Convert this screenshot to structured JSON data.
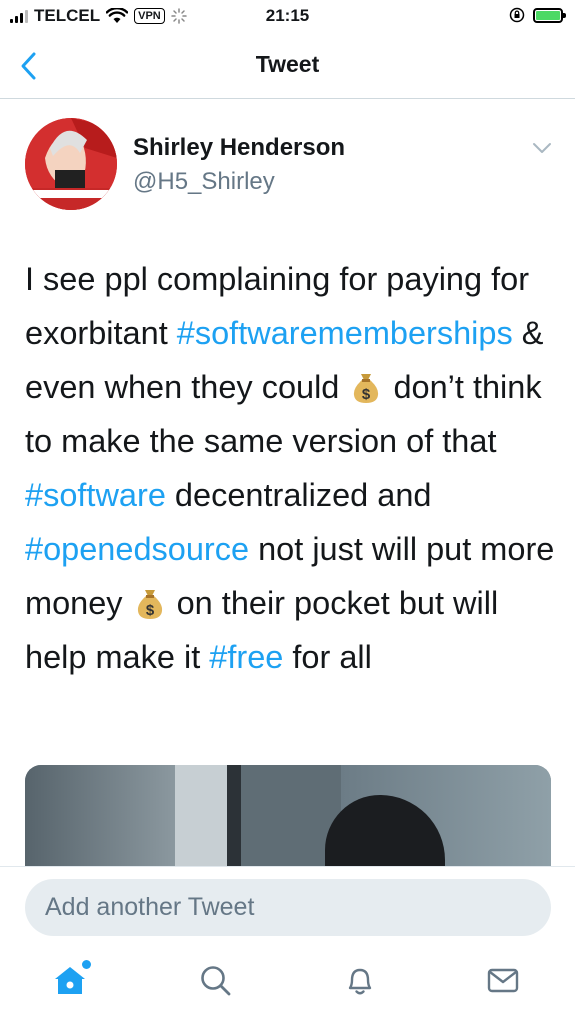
{
  "status_bar": {
    "carrier": "TELCEL",
    "vpn": "VPN",
    "time": "21:15"
  },
  "header": {
    "title": "Tweet"
  },
  "tweet": {
    "author_name": "Shirley Henderson",
    "author_handle": "@H5_Shirley",
    "segments": [
      {
        "text": "I see ppl complaining for paying for exorbitant ",
        "hashtag": false
      },
      {
        "text": "#softwarememberships",
        "hashtag": true
      },
      {
        "text": " & even when they could ",
        "hashtag": false
      },
      {
        "emoji": "money-bag"
      },
      {
        "text": " don’t think to make the same version of that ",
        "hashtag": false
      },
      {
        "text": "#software",
        "hashtag": true
      },
      {
        "text": " decentralized and ",
        "hashtag": false
      },
      {
        "text": "#openedsource",
        "hashtag": true
      },
      {
        "text": " not just will put more money ",
        "hashtag": false
      },
      {
        "emoji": "money-bag"
      },
      {
        "text": " on their pocket but will help make it ",
        "hashtag": false
      },
      {
        "text": "#free",
        "hashtag": true
      },
      {
        "text": " for all",
        "hashtag": false
      }
    ]
  },
  "composer": {
    "placeholder": "Add another Tweet"
  },
  "tab_bar": {
    "items": [
      "home-icon",
      "search-icon",
      "notifications-icon",
      "messages-icon"
    ],
    "home_has_new": true
  },
  "colors": {
    "accent": "#1da1f2",
    "secondary_text": "#657786",
    "input_bg": "#e6ecf0"
  }
}
